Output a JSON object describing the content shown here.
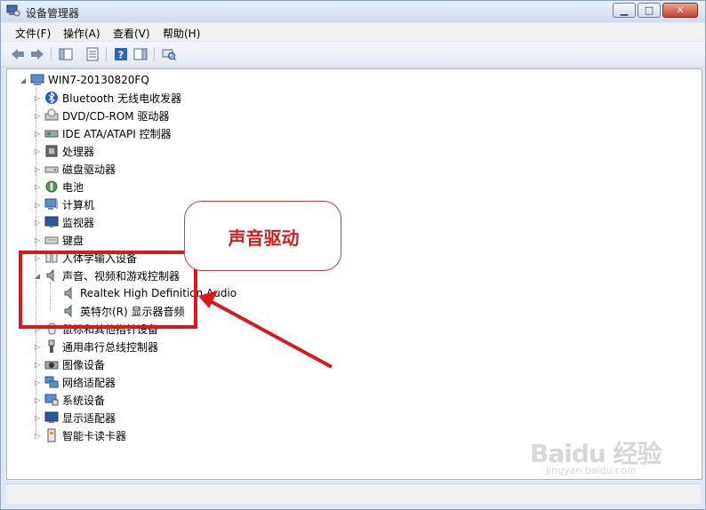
{
  "window": {
    "title": "设备管理器",
    "min_icon": "minimize-icon",
    "max_icon": "maximize-icon",
    "close_icon": "close-icon"
  },
  "menu": [
    "文件(F)",
    "操作(A)",
    "查看(V)",
    "帮助(H)"
  ],
  "toolbar": [
    "back-arrow-icon",
    "forward-arrow-icon",
    "show-hide-tree-icon",
    "properties-icon",
    "help-icon",
    "action-pane-icon",
    "scan-hardware-icon"
  ],
  "tree": {
    "root": "WIN7-20130820FQ",
    "items": [
      {
        "label": "Bluetooth 无线电收发器",
        "icon": "bluetooth-icon"
      },
      {
        "label": "DVD/CD-ROM 驱动器",
        "icon": "dvd-drive-icon"
      },
      {
        "label": "IDE ATA/ATAPI 控制器",
        "icon": "ide-controller-icon"
      },
      {
        "label": "处理器",
        "icon": "processor-icon"
      },
      {
        "label": "磁盘驱动器",
        "icon": "disk-drive-icon"
      },
      {
        "label": "电池",
        "icon": "battery-icon"
      },
      {
        "label": "计算机",
        "icon": "computer-icon"
      },
      {
        "label": "监视器",
        "icon": "monitor-icon"
      },
      {
        "label": "键盘",
        "icon": "keyboard-icon"
      },
      {
        "label": "人体学输入设备",
        "icon": "hid-icon"
      },
      {
        "label": "声音、视频和游戏控制器",
        "icon": "speaker-icon",
        "expanded": true,
        "children": [
          {
            "label": "Realtek High Definition Audio",
            "icon": "speaker-icon"
          },
          {
            "label": "英特尔(R) 显示器音频",
            "icon": "speaker-icon"
          }
        ]
      },
      {
        "label": "鼠标和其他指针设备",
        "icon": "mouse-icon"
      },
      {
        "label": "通用串行总线控制器",
        "icon": "usb-icon"
      },
      {
        "label": "图像设备",
        "icon": "camera-icon"
      },
      {
        "label": "网络适配器",
        "icon": "network-icon"
      },
      {
        "label": "系统设备",
        "icon": "system-device-icon"
      },
      {
        "label": "显示适配器",
        "icon": "display-adapter-icon"
      },
      {
        "label": "智能卡读卡器",
        "icon": "smartcard-icon"
      }
    ]
  },
  "annotation": {
    "callout_text": "声音驱动",
    "color": "#d81a1a"
  },
  "watermark": {
    "brand": "Baidu 经验",
    "url": "jingyan.baidu.com"
  }
}
